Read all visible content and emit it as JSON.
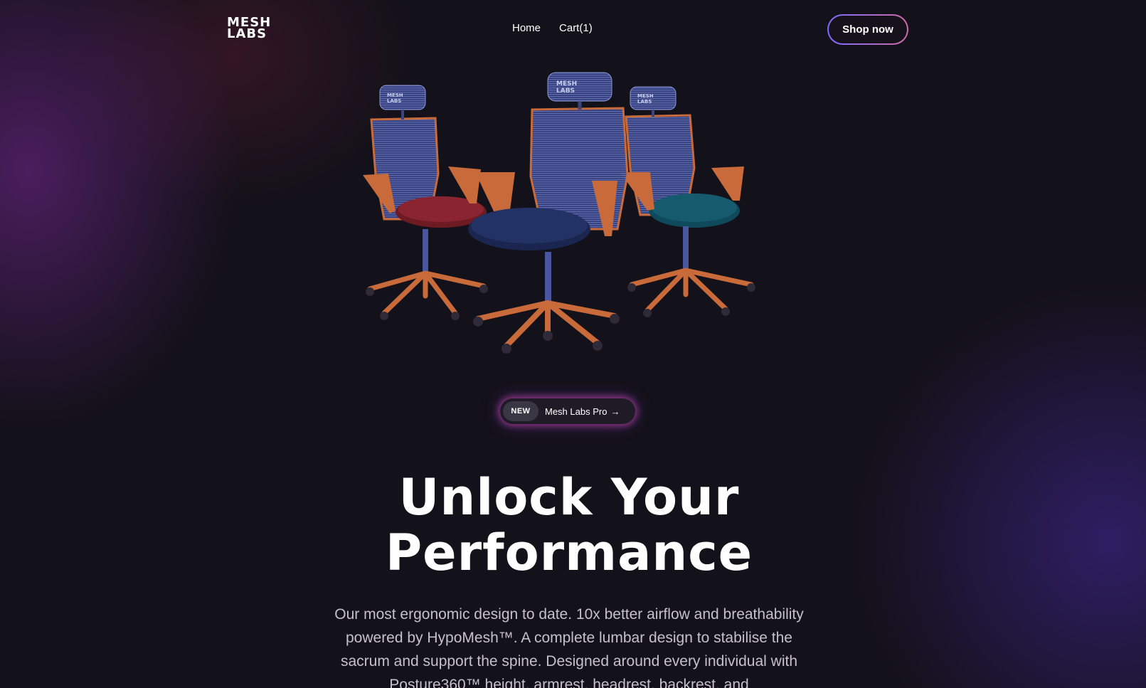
{
  "nav": {
    "logo_line1": "MESH",
    "logo_line2": "LABS",
    "links": [
      {
        "label": "Home"
      },
      {
        "label": "Cart(1)"
      }
    ],
    "cta_label": "Shop now"
  },
  "hero": {
    "chairs": [
      {
        "seat_color": "#6e1a22",
        "frame_color": "#c86a3a",
        "mesh_color": "#3f4e93",
        "headrest_text": "MESH LABS"
      },
      {
        "seat_color": "#1f2e5a",
        "frame_color": "#c86a3a",
        "mesh_color": "#4a5ba8",
        "headrest_text": "MESH LABS"
      },
      {
        "seat_color": "#0f4a5c",
        "frame_color": "#c86a3a",
        "mesh_color": "#3f4e93",
        "headrest_text": "MESH LABS"
      }
    ]
  },
  "badge": {
    "tag": "NEW",
    "text": "Mesh Labs Pro",
    "arrow": "→"
  },
  "headline": {
    "line1": "Unlock Your",
    "line2": "Performance"
  },
  "description": "Our most ergonomic design to date. 10x better airflow and breathability powered by HypoMesh™. A complete lumbar design to stabilise the sacrum and support the spine. Designed around every individual with Posture360™ height, armrest, headrest, backrest, and"
}
